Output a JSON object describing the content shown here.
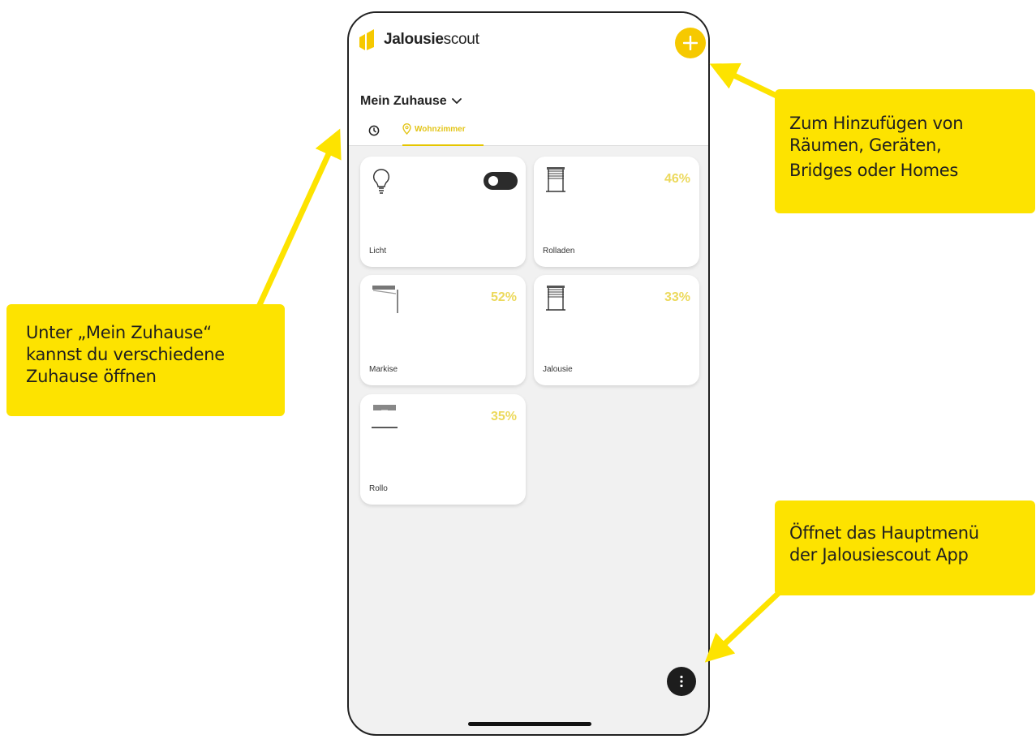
{
  "app": {
    "logo_name": "Jalousie",
    "logo_suffix": "scout",
    "home_title": "Mein Zuhause",
    "tab_room_label": "Wohnzimmer"
  },
  "devices": [
    {
      "label": "Licht",
      "type": "light",
      "state": "on"
    },
    {
      "label": "Rolladen",
      "percent": "46%"
    },
    {
      "label": "Markise",
      "percent": "52%"
    },
    {
      "label": "Jalousie",
      "percent": "33%"
    },
    {
      "label": "Rollo",
      "percent": "35%"
    }
  ],
  "callouts": {
    "add": [
      "Zum Hinzufügen von",
      "Räumen, Geräten,",
      "Bridges oder Homes"
    ],
    "home": [
      "Unter „Mein Zuhause“",
      "kannst du verschiedene",
      "Zuhause öffnen"
    ],
    "menu": [
      "Öffnet das Hauptmenü",
      "der Jalousiescout App"
    ]
  },
  "colors": {
    "accent": "#f6c900",
    "callout": "#fde300",
    "percent": "#ecd95c"
  },
  "icons": [
    "logo-icon",
    "plus-icon",
    "chevron-down-icon",
    "clock-icon",
    "location-pin-icon",
    "lightbulb-icon",
    "shutter-icon",
    "awning-icon",
    "blind-icon",
    "roller-blind-icon",
    "more-vertical-icon"
  ]
}
